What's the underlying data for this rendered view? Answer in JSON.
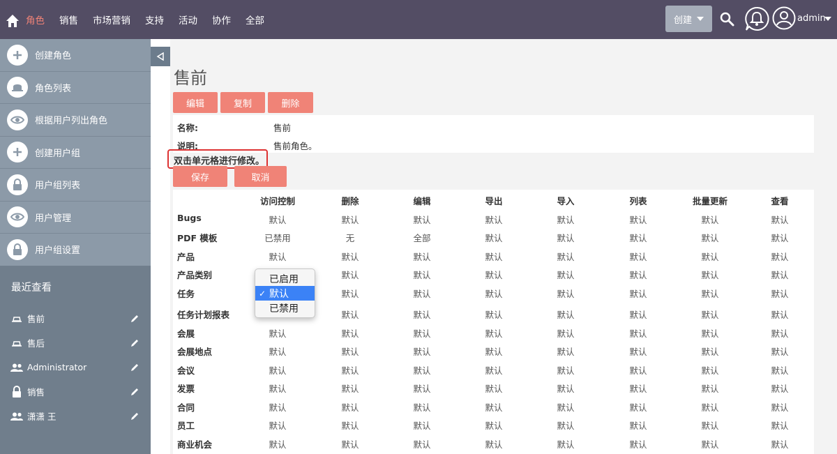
{
  "nav": {
    "items": [
      "角色",
      "销售",
      "市场营销",
      "支持",
      "活动",
      "协作",
      "全部"
    ],
    "active_index": 0,
    "create_label": "创建",
    "user_label": "admin"
  },
  "sidebar": {
    "items": [
      {
        "label": "创建角色",
        "icon": "plus-icon"
      },
      {
        "label": "角色列表",
        "icon": "hat-icon"
      },
      {
        "label": "根据用户列出角色",
        "icon": "eye-icon"
      },
      {
        "label": "创建用户组",
        "icon": "plus-icon"
      },
      {
        "label": "用户组列表",
        "icon": "lock-icon"
      },
      {
        "label": "用户管理",
        "icon": "eye-icon"
      },
      {
        "label": "用户组设置",
        "icon": "lock-icon"
      }
    ],
    "recent_title": "最近查看",
    "recent": [
      {
        "label": "售前",
        "icon": "hat-icon"
      },
      {
        "label": "售后",
        "icon": "hat-icon"
      },
      {
        "label": "Administrator",
        "icon": "users-icon"
      },
      {
        "label": "销售",
        "icon": "lock-icon"
      },
      {
        "label": "潇潇 王",
        "icon": "users-icon"
      }
    ]
  },
  "main": {
    "title": "售前",
    "buttons": {
      "edit": "编辑",
      "copy": "复制",
      "delete": "删除",
      "save": "保存",
      "cancel": "取消"
    },
    "detail": {
      "name_label": "名称:",
      "name_value": "售前",
      "desc_label": "说明:",
      "desc_value": "售前角色。"
    },
    "hint": "双击单元格进行修改。",
    "columns": [
      "访问控制",
      "删除",
      "编辑",
      "导出",
      "导入",
      "列表",
      "批量更新",
      "查看"
    ],
    "rows": [
      {
        "label": "Bugs",
        "values": [
          "默认",
          "默认",
          "默认",
          "默认",
          "默认",
          "默认",
          "默认",
          "默认"
        ]
      },
      {
        "label": "PDF 模板",
        "values": [
          "已禁用",
          "无",
          "全部",
          "默认",
          "默认",
          "默认",
          "默认",
          "默认"
        ]
      },
      {
        "label": "产品",
        "values": [
          "默认",
          "默认",
          "默认",
          "默认",
          "默认",
          "默认",
          "默认",
          "默认"
        ]
      },
      {
        "label": "产品类别",
        "values": [
          "",
          "默认",
          "默认",
          "默认",
          "默认",
          "默认",
          "默认",
          "默认"
        ]
      },
      {
        "label": "任务",
        "values": [
          "",
          "默认",
          "默认",
          "默认",
          "默认",
          "默认",
          "默认",
          "默认"
        ]
      },
      {
        "label": "任务计划报表",
        "values": [
          "",
          "默认",
          "默认",
          "默认",
          "默认",
          "默认",
          "默认",
          "默认"
        ]
      },
      {
        "label": "会展",
        "values": [
          "默认",
          "默认",
          "默认",
          "默认",
          "默认",
          "默认",
          "默认",
          "默认"
        ]
      },
      {
        "label": "会展地点",
        "values": [
          "默认",
          "默认",
          "默认",
          "默认",
          "默认",
          "默认",
          "默认",
          "默认"
        ]
      },
      {
        "label": "会议",
        "values": [
          "默认",
          "默认",
          "默认",
          "默认",
          "默认",
          "默认",
          "默认",
          "默认"
        ]
      },
      {
        "label": "发票",
        "values": [
          "默认",
          "默认",
          "默认",
          "默认",
          "默认",
          "默认",
          "默认",
          "默认"
        ]
      },
      {
        "label": "合同",
        "values": [
          "默认",
          "默认",
          "默认",
          "默认",
          "默认",
          "默认",
          "默认",
          "默认"
        ]
      },
      {
        "label": "员工",
        "values": [
          "默认",
          "默认",
          "默认",
          "默认",
          "默认",
          "默认",
          "默认",
          "默认"
        ]
      },
      {
        "label": "商业机会",
        "values": [
          "默认",
          "默认",
          "默认",
          "默认",
          "默认",
          "默认",
          "默认",
          "默认"
        ]
      }
    ],
    "dropdown": {
      "options": [
        "已启用",
        "默认",
        "已禁用"
      ],
      "selected_index": 1,
      "check": "✓"
    }
  },
  "colors": {
    "topbar": "#534d64",
    "accent": "#f08377",
    "sidebar": "#8c9aa8",
    "recent": "#707e8c",
    "selected": "#3b82f6"
  }
}
